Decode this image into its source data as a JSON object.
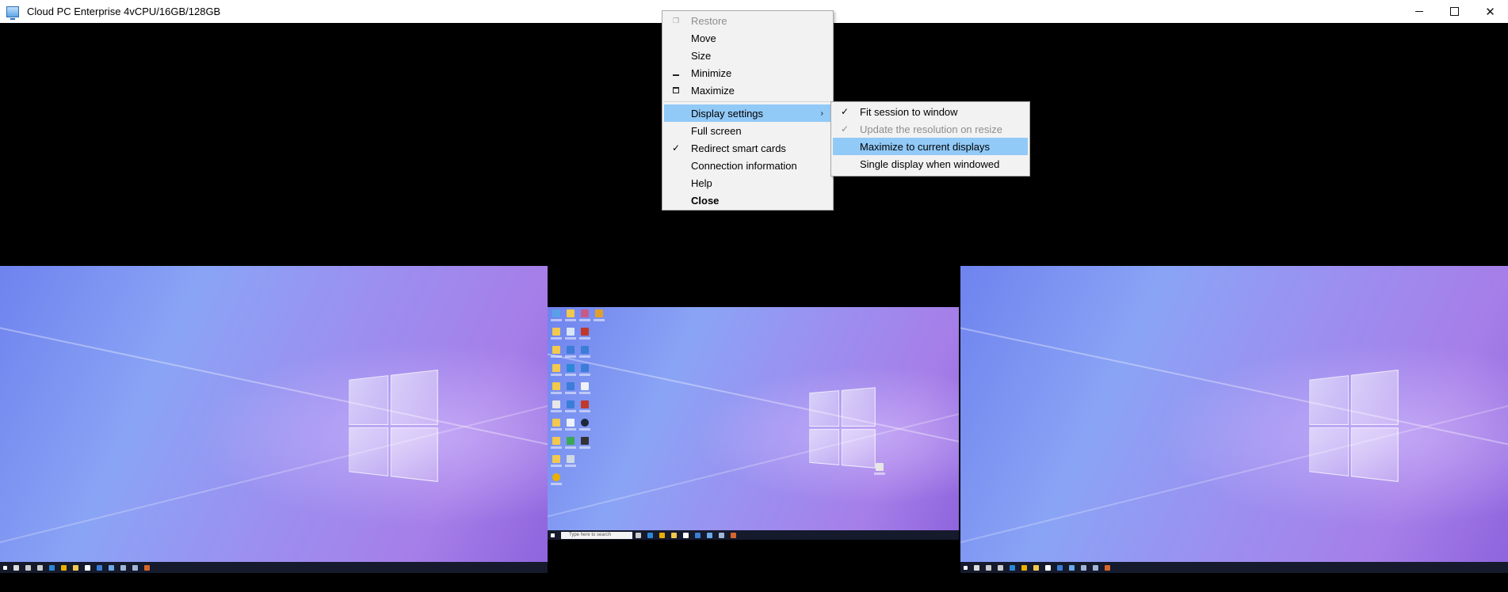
{
  "window": {
    "title": "Cloud PC Enterprise 4vCPU/16GB/128GB",
    "controls": {
      "minimize": "—",
      "maximize": "☐",
      "close": "✕"
    }
  },
  "context_menu": {
    "items": [
      {
        "label": "Restore",
        "disabled": true,
        "icon": "restore-icon"
      },
      {
        "label": "Move"
      },
      {
        "label": "Size"
      },
      {
        "label": "Minimize",
        "icon": "minimize-icon"
      },
      {
        "label": "Maximize",
        "icon": "maximize-icon"
      },
      {
        "label": "Display settings",
        "highlighted": true,
        "submenu_arrow": "›"
      },
      {
        "label": "Full screen"
      },
      {
        "label": "Redirect smart cards",
        "checked": "✓"
      },
      {
        "label": "Connection information"
      },
      {
        "label": "Help"
      },
      {
        "label": "Close",
        "bold": true
      }
    ]
  },
  "display_submenu": {
    "items": [
      {
        "label": "Fit session to window",
        "checked": "✓"
      },
      {
        "label": "Update the resolution on resize",
        "checked": "✓",
        "disabled": true
      },
      {
        "label": "Maximize to current displays",
        "highlighted": true
      },
      {
        "label": "Single display when windowed"
      }
    ]
  },
  "remote_desktop": {
    "search_placeholder": "Type here to search",
    "colors": {
      "taskbar": "#151a2c",
      "menu_highlight": "#91c9f7",
      "menu_bg": "#f2f2f2"
    }
  }
}
